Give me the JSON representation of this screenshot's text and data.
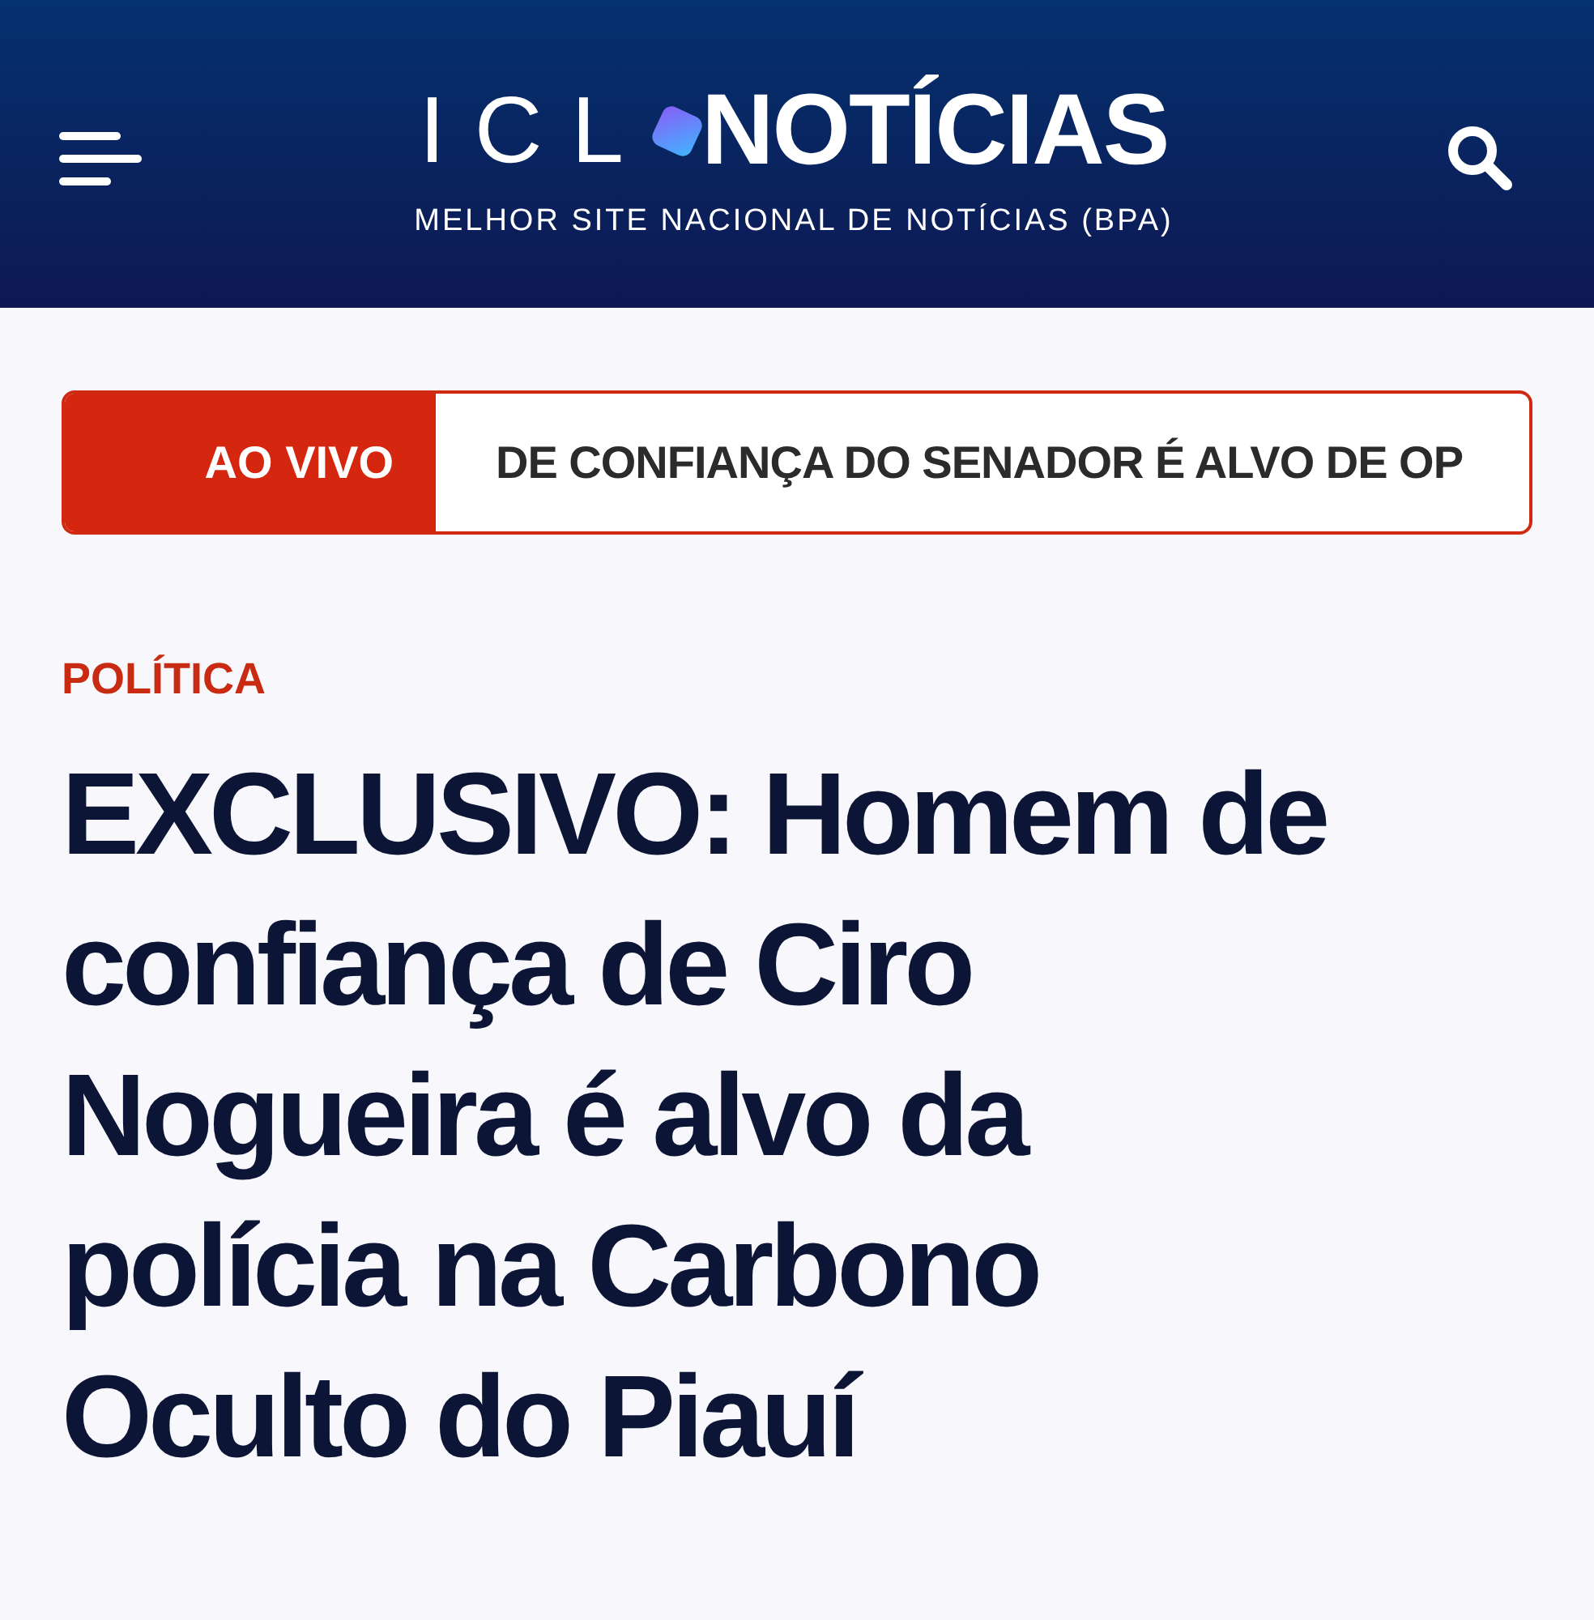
{
  "header": {
    "logo_left": "ICL",
    "logo_right": "NOTÍCIAS",
    "tagline": "MELHOR SITE NACIONAL DE NOTÍCIAS (BPA)"
  },
  "live_bar": {
    "label": "AO VIVO",
    "ticker": "DE CONFIANÇA DO SENADOR É ALVO DE OP"
  },
  "article": {
    "category": "POLÍTICA",
    "headline": "EXCLUSIVO: Homem de confiança de Ciro Nogueira é alvo da polícia na Carbono Oculto do Piauí"
  }
}
